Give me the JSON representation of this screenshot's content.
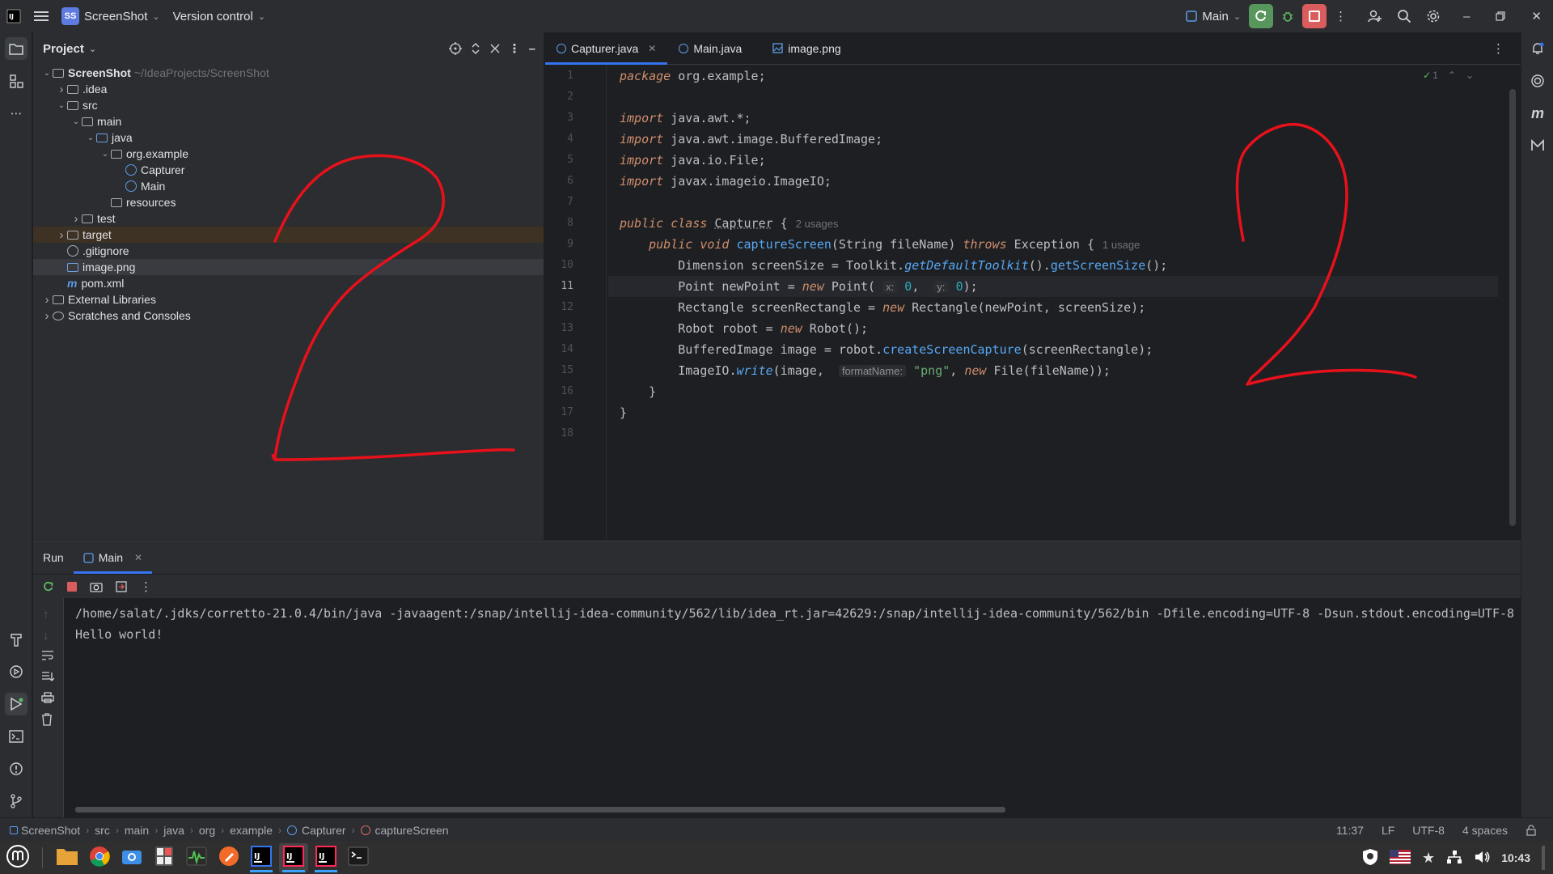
{
  "titlebar": {
    "project_badge": "SS",
    "project_name": "ScreenShot",
    "vcs": "Version control",
    "run_config": "Main"
  },
  "project_panel": {
    "title": "Project",
    "tree": [
      {
        "label": "ScreenShot",
        "sub": "~/IdeaProjects/ScreenShot",
        "depth": 0,
        "arrow": "down",
        "kind": "module"
      },
      {
        "label": ".idea",
        "depth": 1,
        "arrow": "right",
        "kind": "folder"
      },
      {
        "label": "src",
        "depth": 1,
        "arrow": "down",
        "kind": "folder"
      },
      {
        "label": "main",
        "depth": 2,
        "arrow": "down",
        "kind": "folder"
      },
      {
        "label": "java",
        "depth": 3,
        "arrow": "down",
        "kind": "folder-blue"
      },
      {
        "label": "org.example",
        "depth": 4,
        "arrow": "down",
        "kind": "package"
      },
      {
        "label": "Capturer",
        "depth": 5,
        "arrow": "",
        "kind": "class"
      },
      {
        "label": "Main",
        "depth": 5,
        "arrow": "",
        "kind": "class"
      },
      {
        "label": "resources",
        "depth": 4,
        "arrow": "",
        "kind": "folder"
      },
      {
        "label": "test",
        "depth": 2,
        "arrow": "right",
        "kind": "folder"
      },
      {
        "label": "target",
        "depth": 1,
        "arrow": "right",
        "kind": "folder"
      },
      {
        "label": ".gitignore",
        "depth": 1,
        "arrow": "",
        "kind": "ignore"
      },
      {
        "label": "image.png",
        "depth": 1,
        "arrow": "",
        "kind": "image"
      },
      {
        "label": "pom.xml",
        "depth": 1,
        "arrow": "",
        "kind": "maven"
      },
      {
        "label": "External Libraries",
        "depth": 0,
        "arrow": "right",
        "kind": "libs"
      },
      {
        "label": "Scratches and Consoles",
        "depth": 0,
        "arrow": "right",
        "kind": "scratch"
      }
    ]
  },
  "editor": {
    "tabs": [
      {
        "label": "Capturer.java",
        "active": true
      },
      {
        "label": "Main.java",
        "active": false
      },
      {
        "label": "image.png",
        "active": false
      }
    ],
    "inspection_count": "1",
    "line_numbers": [
      "1",
      "2",
      "3",
      "4",
      "5",
      "6",
      "7",
      "8",
      "9",
      "10",
      "11",
      "12",
      "13",
      "14",
      "15",
      "16",
      "17",
      "18"
    ],
    "hints": {
      "class_usages": "2 usages",
      "method_usages": "1 usage",
      "x": "x:",
      "y": "y:",
      "formatName": "formatName:"
    }
  },
  "run_panel": {
    "tab_run": "Run",
    "tab_main": "Main",
    "console": [
      "/home/salat/.jdks/corretto-21.0.4/bin/java -javaagent:/snap/intellij-idea-community/562/lib/idea_rt.jar=42629:/snap/intellij-idea-community/562/bin -Dfile.encoding=UTF-8 -Dsun.stdout.encoding=UTF-8 -",
      "Hello world!"
    ]
  },
  "statusbar": {
    "breadcrumbs": [
      "ScreenShot",
      "src",
      "main",
      "java",
      "org",
      "example",
      "Capturer",
      "captureScreen"
    ],
    "position": "11:37",
    "line_sep": "LF",
    "encoding": "UTF-8",
    "indent": "4 spaces"
  },
  "taskbar": {
    "clock": "10:43"
  },
  "colors": {
    "accent": "#3574f0",
    "run_green": "#57965c",
    "stop_red": "#db5c5c",
    "drawing_red": "#e8111b"
  }
}
